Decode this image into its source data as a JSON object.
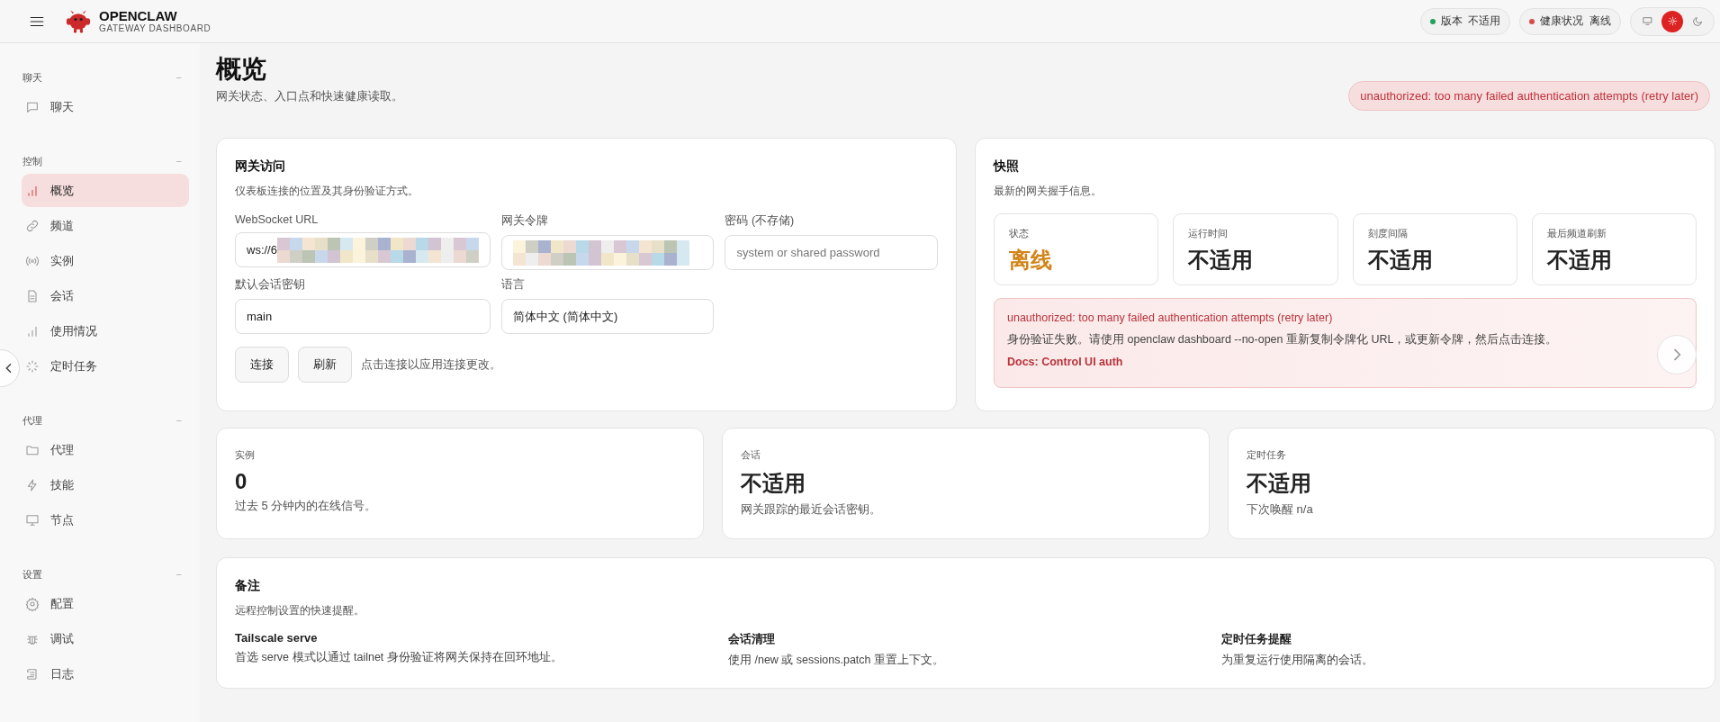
{
  "header": {
    "brand": "OPENCLAW",
    "subtitle": "GATEWAY DASHBOARD",
    "pills": [
      {
        "label": "版本",
        "value": "不适用",
        "color": "#22a05a"
      },
      {
        "label": "健康状况",
        "value": "离线",
        "color": "#d94b4b"
      }
    ],
    "theme_modes": [
      {
        "kind": "system",
        "selected": false
      },
      {
        "kind": "light",
        "selected": true
      },
      {
        "kind": "dark",
        "selected": false
      }
    ]
  },
  "sidebar": {
    "groups": [
      {
        "title": "聊天",
        "toggle": "−",
        "items": [
          {
            "label": "聊天",
            "kind": "chat",
            "selected": false
          }
        ]
      },
      {
        "title": "控制",
        "toggle": "−",
        "items": [
          {
            "label": "概览",
            "kind": "bars",
            "selected": true
          },
          {
            "label": "频道",
            "kind": "link",
            "selected": false
          },
          {
            "label": "实例",
            "kind": "radio",
            "selected": false
          },
          {
            "label": "会话",
            "kind": "file",
            "selected": false
          },
          {
            "label": "使用情况",
            "kind": "bars",
            "selected": false
          },
          {
            "label": "定时任务",
            "kind": "loader",
            "selected": false
          }
        ]
      },
      {
        "title": "代理",
        "toggle": "−",
        "items": [
          {
            "label": "代理",
            "kind": "folder",
            "selected": false
          },
          {
            "label": "技能",
            "kind": "bolt",
            "selected": false
          },
          {
            "label": "节点",
            "kind": "monitor",
            "selected": false
          }
        ]
      },
      {
        "title": "设置",
        "toggle": "−",
        "items": [
          {
            "label": "配置",
            "kind": "gear",
            "selected": false
          },
          {
            "label": "调试",
            "kind": "bug",
            "selected": false
          },
          {
            "label": "日志",
            "kind": "scroll",
            "selected": false
          }
        ]
      }
    ]
  },
  "page": {
    "title": "概览",
    "subtitle": "网关状态、入口点和快速健康读取。",
    "error_badge": "unauthorized: too many failed authentication attempts (retry later)"
  },
  "gateway_access": {
    "title": "网关访问",
    "subtitle": "仪表板连接的位置及其身份验证方式。",
    "fields": [
      {
        "label": "WebSocket URL",
        "value": "ws://6",
        "obscured": true
      },
      {
        "label": "网关令牌",
        "obscured": true
      },
      {
        "label": "密码 (不存储)",
        "placeholder": "system or shared password",
        "obscured": false
      },
      {
        "label": "默认会话密钥",
        "value": "main",
        "obscured": false
      },
      {
        "label": "语言",
        "value": "简体中文 (简体中文)",
        "obscured": false
      }
    ],
    "buttons": [
      "连接",
      "刷新"
    ],
    "hint": "点击连接以应用连接更改。"
  },
  "snapshot": {
    "title": "快照",
    "subtitle": "最新的网关握手信息。",
    "stats": [
      {
        "label": "状态",
        "value": "离线",
        "warning": true
      },
      {
        "label": "运行时间",
        "value": "不适用",
        "warning": false
      },
      {
        "label": "刻度间隔",
        "value": "不适用",
        "warning": false
      },
      {
        "label": "最后频道刷新",
        "value": "不适用",
        "warning": false
      }
    ],
    "alert": {
      "message": "unauthorized: too many failed authentication attempts (retry later)",
      "detail": "身份验证失败。请使用 openclaw dashboard --no-open 重新复制令牌化 URL，或更新令牌，然后点击连接。",
      "link": "Docs: Control UI auth"
    }
  },
  "summary_cards": [
    {
      "label": "实例",
      "value": "0",
      "note": "过去 5 分钟内的在线信号。"
    },
    {
      "label": "会话",
      "value": "不适用",
      "note": "网关跟踪的最近会话密钥。"
    },
    {
      "label": "定时任务",
      "value": "不适用",
      "note": "下次唤醒 n/a"
    }
  ],
  "notes": {
    "title": "备注",
    "subtitle": "远程控制设置的快速提醒。",
    "items": [
      {
        "title": "Tailscale serve",
        "text": "首选 serve 模式以通过 tailnet 身份验证将网关保持在回环地址。"
      },
      {
        "title": "会话清理",
        "text": "使用 /new 或 sessions.patch 重置上下文。"
      },
      {
        "title": "定时任务提醒",
        "text": "为重复运行使用隔离的会话。"
      }
    ]
  }
}
